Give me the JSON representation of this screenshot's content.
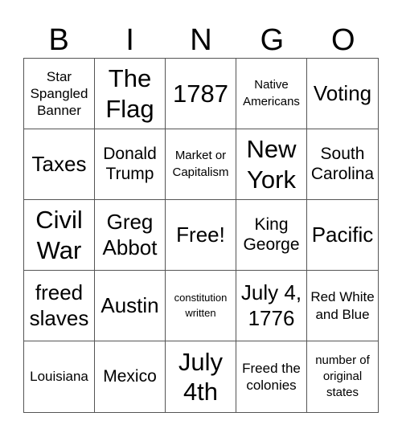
{
  "header": [
    "B",
    "I",
    "N",
    "G",
    "O"
  ],
  "cells": [
    {
      "text": "Star Spangled Banner",
      "size": "s-s"
    },
    {
      "text": "The Flag",
      "size": "s-xl"
    },
    {
      "text": "1787",
      "size": "s-xl"
    },
    {
      "text": "Native Americans",
      "size": "s-xs"
    },
    {
      "text": "Voting",
      "size": "s-l"
    },
    {
      "text": "Taxes",
      "size": "s-l"
    },
    {
      "text": "Donald Trump",
      "size": "s-m"
    },
    {
      "text": "Market or Capitalism",
      "size": "s-xs"
    },
    {
      "text": "New York",
      "size": "s-xl"
    },
    {
      "text": "South Carolina",
      "size": "s-m"
    },
    {
      "text": "Civil War",
      "size": "s-xl"
    },
    {
      "text": "Greg Abbot",
      "size": "s-l"
    },
    {
      "text": "Free!",
      "size": "s-l"
    },
    {
      "text": "King George",
      "size": "s-m"
    },
    {
      "text": "Pacific",
      "size": "s-l"
    },
    {
      "text": "freed slaves",
      "size": "s-l"
    },
    {
      "text": "Austin",
      "size": "s-l"
    },
    {
      "text": "constitution written",
      "size": "s-xxs"
    },
    {
      "text": "July 4, 1776",
      "size": "s-l"
    },
    {
      "text": "Red White and Blue",
      "size": "s-s"
    },
    {
      "text": "Louisiana",
      "size": "s-s"
    },
    {
      "text": "Mexico",
      "size": "s-m"
    },
    {
      "text": "July 4th",
      "size": "s-xl"
    },
    {
      "text": "Freed the colonies",
      "size": "s-s"
    },
    {
      "text": "number of original states",
      "size": "s-xs"
    }
  ]
}
